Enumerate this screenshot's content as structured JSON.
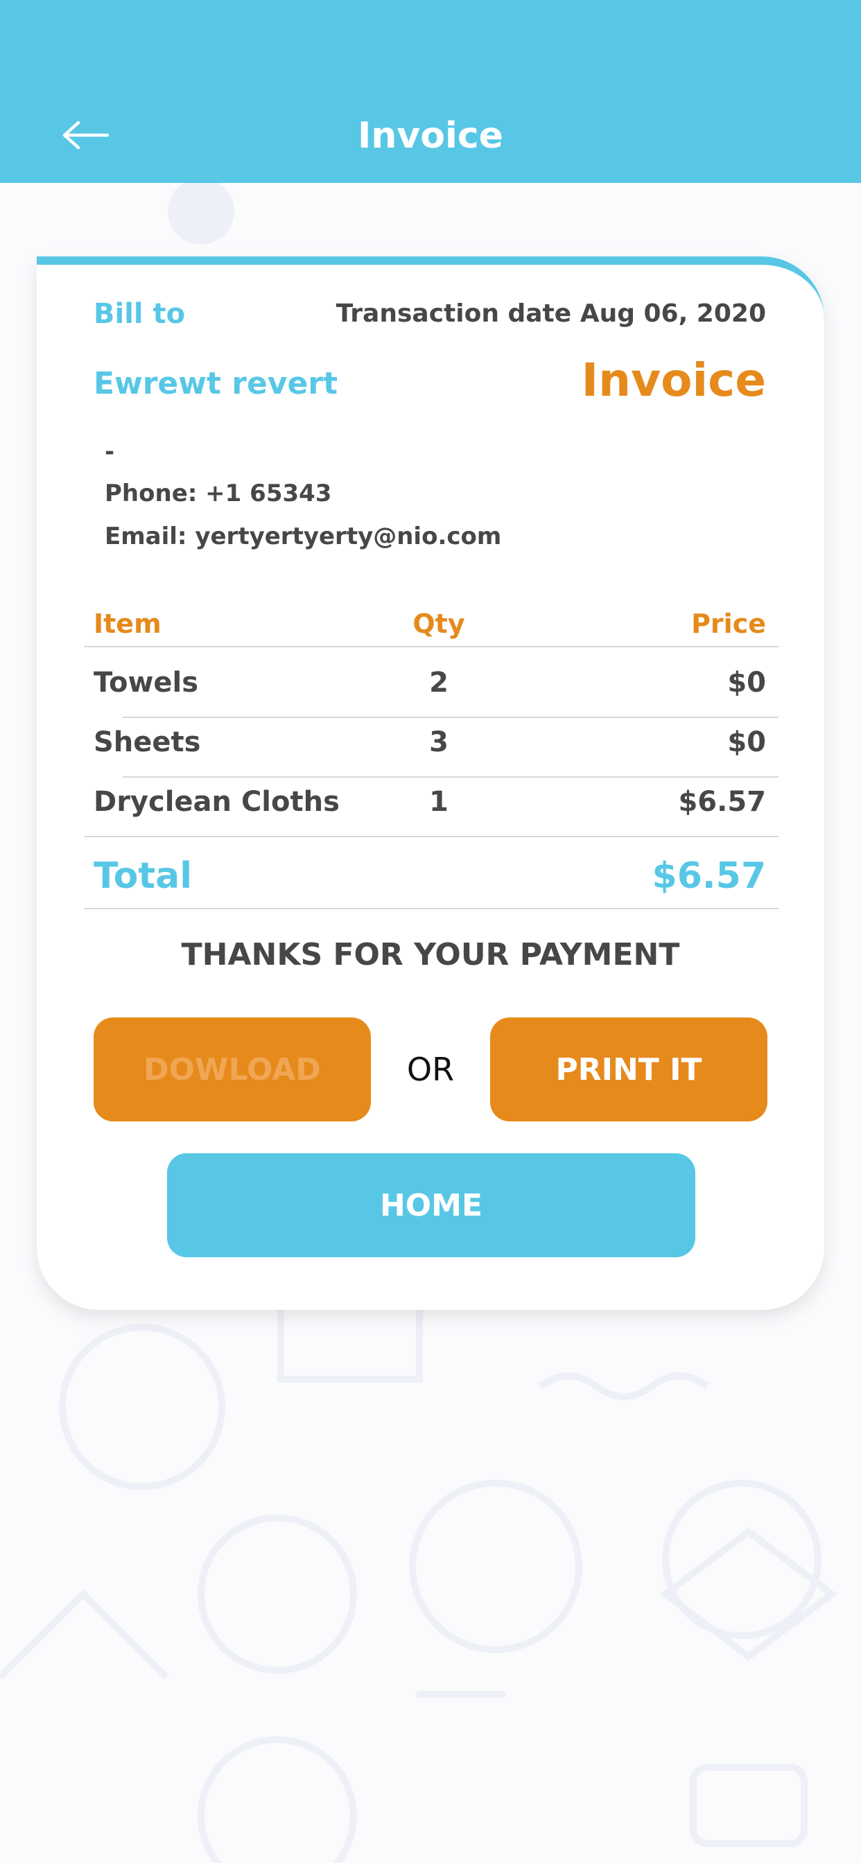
{
  "colors": {
    "primary": "#58c7e6",
    "accent": "#e68a1c",
    "text": "#474747",
    "download_text": "#f1a653"
  },
  "header": {
    "title": "Invoice",
    "back_icon": "arrow-left-icon"
  },
  "invoice": {
    "bill_to_label": "Bill to",
    "transaction_date": "Transaction date Aug 06, 2020",
    "customer_name": "Ewrewt revert",
    "heading": "Invoice",
    "address": "-",
    "phone": "Phone: +1 65343",
    "email": "Email: yertyertyerty@nio.com",
    "columns": {
      "item": "Item",
      "qty": "Qty",
      "price": "Price"
    },
    "items": [
      {
        "name": "Towels",
        "qty": "2",
        "price": "$0"
      },
      {
        "name": "Sheets",
        "qty": "3",
        "price": "$0"
      },
      {
        "name": "Dryclean Cloths",
        "qty": "1",
        "price": "$6.57"
      }
    ],
    "total_label": "Total",
    "total_value": "$6.57",
    "thanks": "THANKS FOR YOUR PAYMENT"
  },
  "actions": {
    "download_label": "DOWLOAD",
    "or_label": "OR",
    "print_label": "PRINT IT",
    "home_label": "HOME"
  }
}
